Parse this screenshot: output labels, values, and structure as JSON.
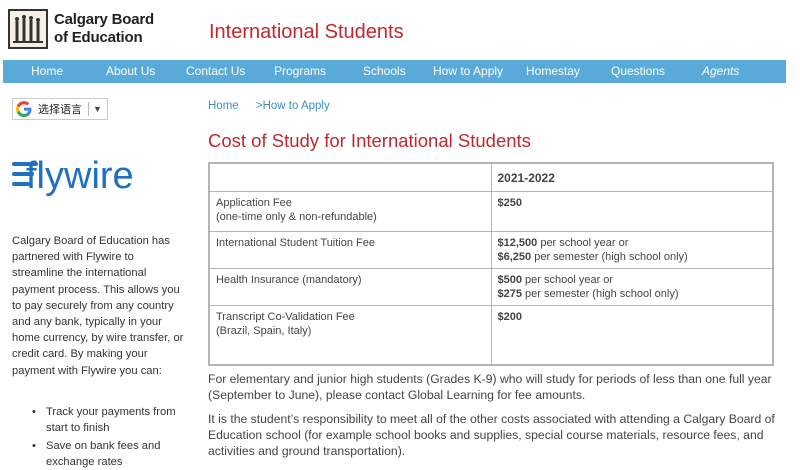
{
  "header": {
    "logo_line1": "Calgary Board",
    "logo_line2": "of Education",
    "site_title": "International Students"
  },
  "nav": {
    "items": [
      "Home",
      "About Us",
      "Contact Us",
      "Programs",
      "Schools",
      "How to Apply",
      "Homestay",
      "Questions",
      "Agents"
    ]
  },
  "translate": {
    "label": "选择语言",
    "arrow": "▼"
  },
  "sidebar": {
    "brand": "flywire",
    "intro": "Calgary Board of Education has partnered with Flywire to streamline the international payment process. This allows you to pay securely from any country and any bank, typically in your home currency, by wire transfer, or credit card. By making your payment with Flywire you can:",
    "benefits": [
      "Track your payments from start to finish",
      "Save on bank fees and exchange rates"
    ]
  },
  "breadcrumb": {
    "home": "Home",
    "current": ">How to Apply"
  },
  "main": {
    "title": "Cost of Study for International Students",
    "table": {
      "header": [
        "",
        "2021-2022"
      ],
      "rows": [
        {
          "label1": "Application Fee",
          "label2": "(one-time only & non-refundable)",
          "amt1": "$250",
          "txt1": "",
          "amt2": "",
          "txt2": ""
        },
        {
          "label1": "International Student Tuition Fee",
          "label2": "",
          "amt1": "$12,500",
          "txt1": " per school year or",
          "amt2": "$6,250",
          "txt2": " per semester (high school only)"
        },
        {
          "label1": "Health Insurance (mandatory)",
          "label2": "",
          "amt1": "$500",
          "txt1": " per school year or",
          "amt2": "$275",
          "txt2": " per semester (high school only)"
        },
        {
          "label1": "Transcript Co-Validation Fee",
          "label2": "(Brazil, Spain, Italy)",
          "amt1": "$200",
          "txt1": "",
          "amt2": "",
          "txt2": ""
        }
      ]
    },
    "para1": "For elementary and junior high students (Grades K-9) who will study for periods of less than one full year (September to June), please contact Global Learning for fee amounts.",
    "para2": "It is the student’s responsibility to meet all of the other costs associated with attending a Calgary Board of Education school (for example school books and supplies, special course materials, resource fees, and activities and ground transportation)."
  },
  "colors": {
    "nav_bg": "#5aaad9",
    "title_red": "#c0282d",
    "link_blue": "#3a8ec4",
    "flywire_blue": "#1f6fc2"
  }
}
